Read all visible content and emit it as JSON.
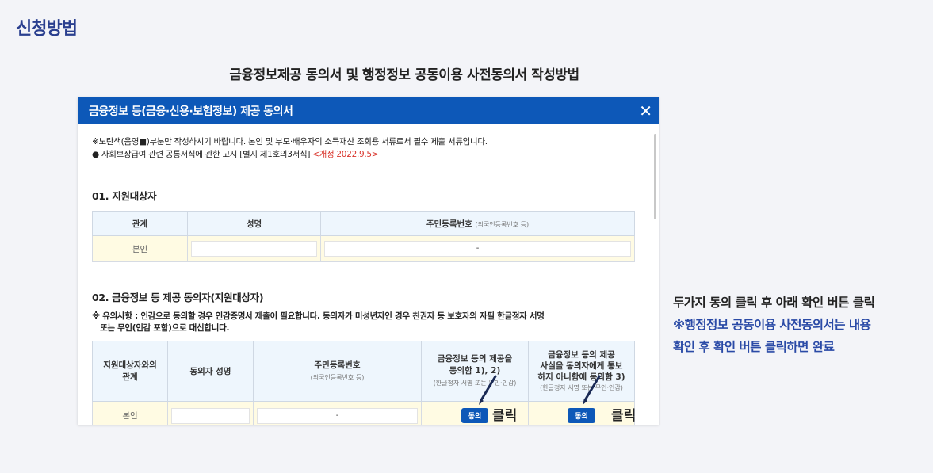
{
  "page": {
    "heading": "신청방법",
    "subheading": "금융정보제공 동의서 및 행정정보 공동이용 사전동의서 작성방법"
  },
  "modal": {
    "title": "금융정보 등(금융·신용·보험정보) 제공 동의서",
    "close": "✕",
    "notice_line1": "※노란색(음영■)부분만 작성하시기 바랍니다. 본인 및 부모·배우자의 소득재산 조회용 서류로서 필수 제출 서류입니다.",
    "notice_line2": "● 사회보장급여 관련 공통서식에 관한 고시 [별지 제1호의3서식]",
    "notice_revision": "<개정 2022.9.5>",
    "section1": {
      "title": "01. 지원대상자",
      "headers": [
        "관계",
        "성명",
        "주민등록번호"
      ],
      "rrn_note": "(외국인등록번호 등)",
      "row_relation": "본인",
      "rrn_dash": "-"
    },
    "section2": {
      "title": "02. 금융정보 등 제공 동의자(지원대상자)",
      "caution_line1": "※ 유의사항 : 인감으로 동의할 경우 인감증명서 제출이 필요합니다. 동의자가 미성년자인 경우 친권자 등 보호자의 자필 한글정자 서명",
      "caution_line2": "또는 무인(인감 포함)으로 대신합니다.",
      "header_relation_1": "지원대상자와의",
      "header_relation_2": "관계",
      "header_name": "동의자 성명",
      "header_rrn": "주민등록번호",
      "header_rrn_note": "(외국인등록번호 등)",
      "header_consent1_1": "금융정보 등의 제공을",
      "header_consent1_2": "동의함 1), 2)",
      "header_consent1_note": "(한글정자 서명 또는 무인·인감)",
      "header_consent2_1": "금융정보 등의 제공",
      "header_consent2_2": "사실을 동의자에게 통보",
      "header_consent2_3": "하지 아니함에 동의함 3)",
      "header_consent2_note": "(한글정자 서명 또는 무인·인감)",
      "row_relation": "본인",
      "rrn_dash": "-",
      "agree_button": "동의",
      "click_label": "클릭"
    }
  },
  "side": {
    "line1": "두가지 동의 클릭 후 아래 확인 버튼 클릭",
    "line2": "※행정정보 공동이용 사전동의서는 내용",
    "line3": "확인 후 확인 버튼 클릭하면 완료"
  },
  "colors": {
    "brand_blue": "#0d58b8",
    "heading_navy": "#2a3f8f",
    "highlight_yellow": "#fffbe3",
    "revision_red": "#d9342b"
  },
  "icons": [
    "close-icon",
    "pen-icon"
  ]
}
